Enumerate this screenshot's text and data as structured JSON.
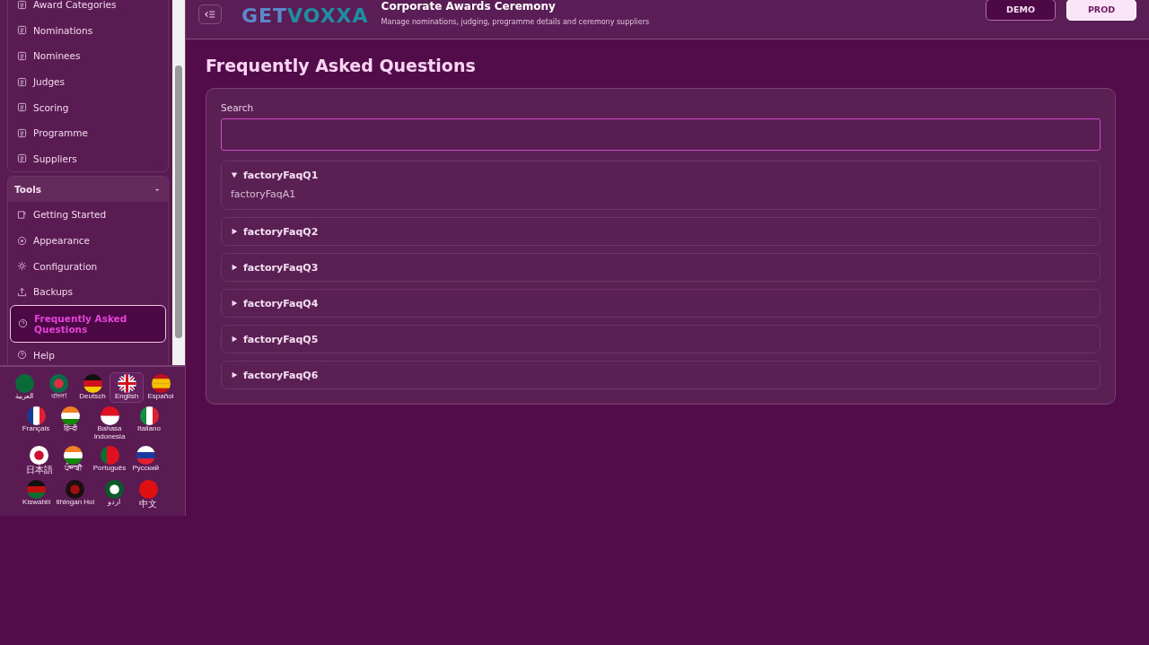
{
  "sidebar": {
    "items": [
      {
        "label": "Award Categories",
        "selected": false
      },
      {
        "label": "Nominations",
        "selected": false
      },
      {
        "label": "Nominees",
        "selected": false
      },
      {
        "label": "Judges",
        "selected": false
      },
      {
        "label": "Scoring",
        "selected": false
      },
      {
        "label": "Programme",
        "selected": false
      },
      {
        "label": "Suppliers",
        "selected": false
      }
    ],
    "tools": {
      "title": "Tools",
      "toggle": "-",
      "expanded": true,
      "items": [
        {
          "label": "Getting Started",
          "selected": false
        },
        {
          "label": "Appearance",
          "selected": false
        },
        {
          "label": "Configuration",
          "selected": false
        },
        {
          "label": "Backups",
          "selected": false
        },
        {
          "label": "Frequently Asked Questions",
          "selected": true
        },
        {
          "label": "Help",
          "selected": false
        }
      ]
    },
    "languages": [
      {
        "label": "العربية",
        "selected": false
      },
      {
        "label": "বাংলা",
        "selected": false
      },
      {
        "label": "Deutsch",
        "selected": false
      },
      {
        "label": "English",
        "selected": true
      },
      {
        "label": "Español",
        "selected": false
      },
      {
        "label": "Français",
        "selected": false
      },
      {
        "label": "हिन्दी",
        "selected": false
      },
      {
        "label": "Bahasa Indonesia",
        "selected": false
      },
      {
        "label": "Italiano",
        "selected": false
      },
      {
        "label": "日本語",
        "selected": false
      },
      {
        "label": "ਪੰਜਾਬੀ",
        "selected": false
      },
      {
        "label": "Português",
        "selected": false
      },
      {
        "label": "Русский",
        "selected": false
      },
      {
        "label": "Kiswahili",
        "selected": false
      },
      {
        "label": "tlhIngan Hol",
        "selected": false
      },
      {
        "label": "اردو",
        "selected": false
      },
      {
        "label": "中文",
        "selected": false
      }
    ]
  },
  "header": {
    "logo": "GETVOXXA",
    "title": "Corporate Awards Ceremony",
    "subtitle": "Manage nominations, judging, programme details and ceremony suppliers",
    "environments": [
      {
        "label": "DEMO",
        "selected": false
      },
      {
        "label": "PROD",
        "selected": true
      }
    ]
  },
  "page": {
    "title": "Frequently Asked Questions",
    "search": {
      "label": "Search"
    },
    "faqs": [
      {
        "question": "factoryFaqQ1",
        "answer": "factoryFaqA1",
        "expanded": true
      },
      {
        "question": "factoryFaqQ2",
        "expanded": false
      },
      {
        "question": "factoryFaqQ3",
        "expanded": false
      },
      {
        "question": "factoryFaqQ4",
        "expanded": false
      },
      {
        "question": "factoryFaqQ5",
        "expanded": false
      },
      {
        "question": "factoryFaqQ6",
        "expanded": false
      }
    ]
  }
}
